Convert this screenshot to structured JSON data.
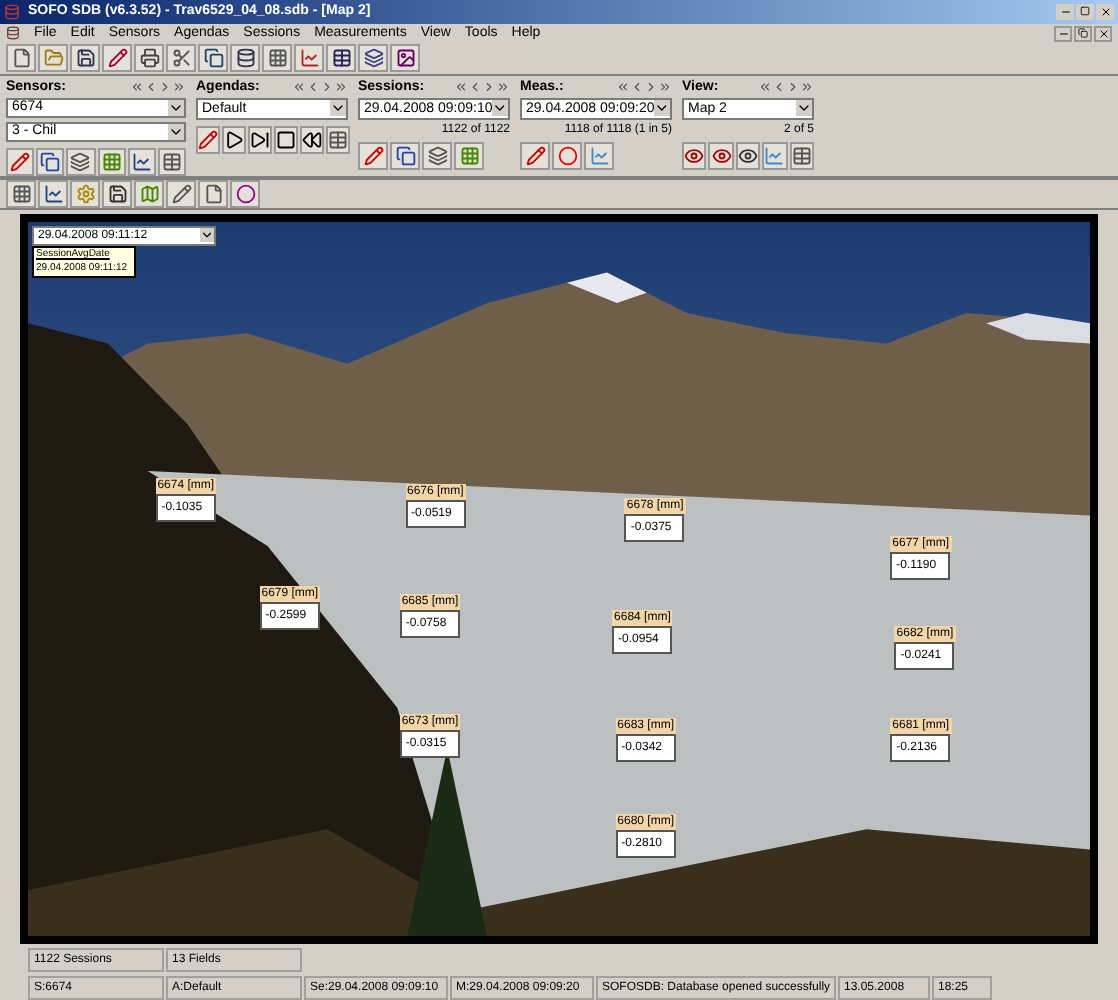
{
  "window": {
    "title": "SOFO SDB (v6.3.52) - Trav6529_04_08.sdb - [Map 2]"
  },
  "menu": [
    "File",
    "Edit",
    "Sensors",
    "Agendas",
    "Sessions",
    "Measurements",
    "View",
    "Tools",
    "Help"
  ],
  "groups": [
    {
      "label": "Sensors:",
      "combos": [
        "6674",
        "3 - Chil"
      ]
    },
    {
      "label": "Agendas:",
      "combos": [
        "Default"
      ]
    },
    {
      "label": "Sessions:",
      "combos": [
        "29.04.2008 09:09:10"
      ],
      "count": "1122 of 1122"
    },
    {
      "label": "Meas.:",
      "combos": [
        "29.04.2008 09:09:20"
      ],
      "count": "1118 of 1118 (1 in 5)"
    },
    {
      "label": "View:",
      "combos": [
        "Map 2"
      ],
      "count": "2 of 5"
    }
  ],
  "map": {
    "date_select": "29.04.2008 09:11:12",
    "tooltip_title": "SessionAvgDate",
    "tooltip_value": "29.04.2008 09:11:12",
    "sensors": [
      {
        "name": "6674 [mm]",
        "value": "-0.1035"
      },
      {
        "name": "6676 [mm]",
        "value": "-0.0519"
      },
      {
        "name": "6678 [mm]",
        "value": "-0.0375"
      },
      {
        "name": "6677 [mm]",
        "value": "-0.1190"
      },
      {
        "name": "6679 [mm]",
        "value": "-0.2599"
      },
      {
        "name": "6685 [mm]",
        "value": "-0.0758"
      },
      {
        "name": "6684 [mm]",
        "value": "-0.0954"
      },
      {
        "name": "6682 [mm]",
        "value": "-0.0241"
      },
      {
        "name": "6673 [mm]",
        "value": "-0.0315"
      },
      {
        "name": "6683 [mm]",
        "value": "-0.0342"
      },
      {
        "name": "6681 [mm]",
        "value": "-0.2136"
      },
      {
        "name": "6680 [mm]",
        "value": "-0.2810"
      }
    ]
  },
  "summary": [
    "1122 Sessions",
    "13 Fields"
  ],
  "status_bar": [
    "S:6674",
    "A:Default",
    "Se:29.04.2008 09:09:10",
    "M:29.04.2008 09:09:20",
    "SOFOSDB: Database opened successfully",
    "13.05.2008",
    "18:25"
  ]
}
